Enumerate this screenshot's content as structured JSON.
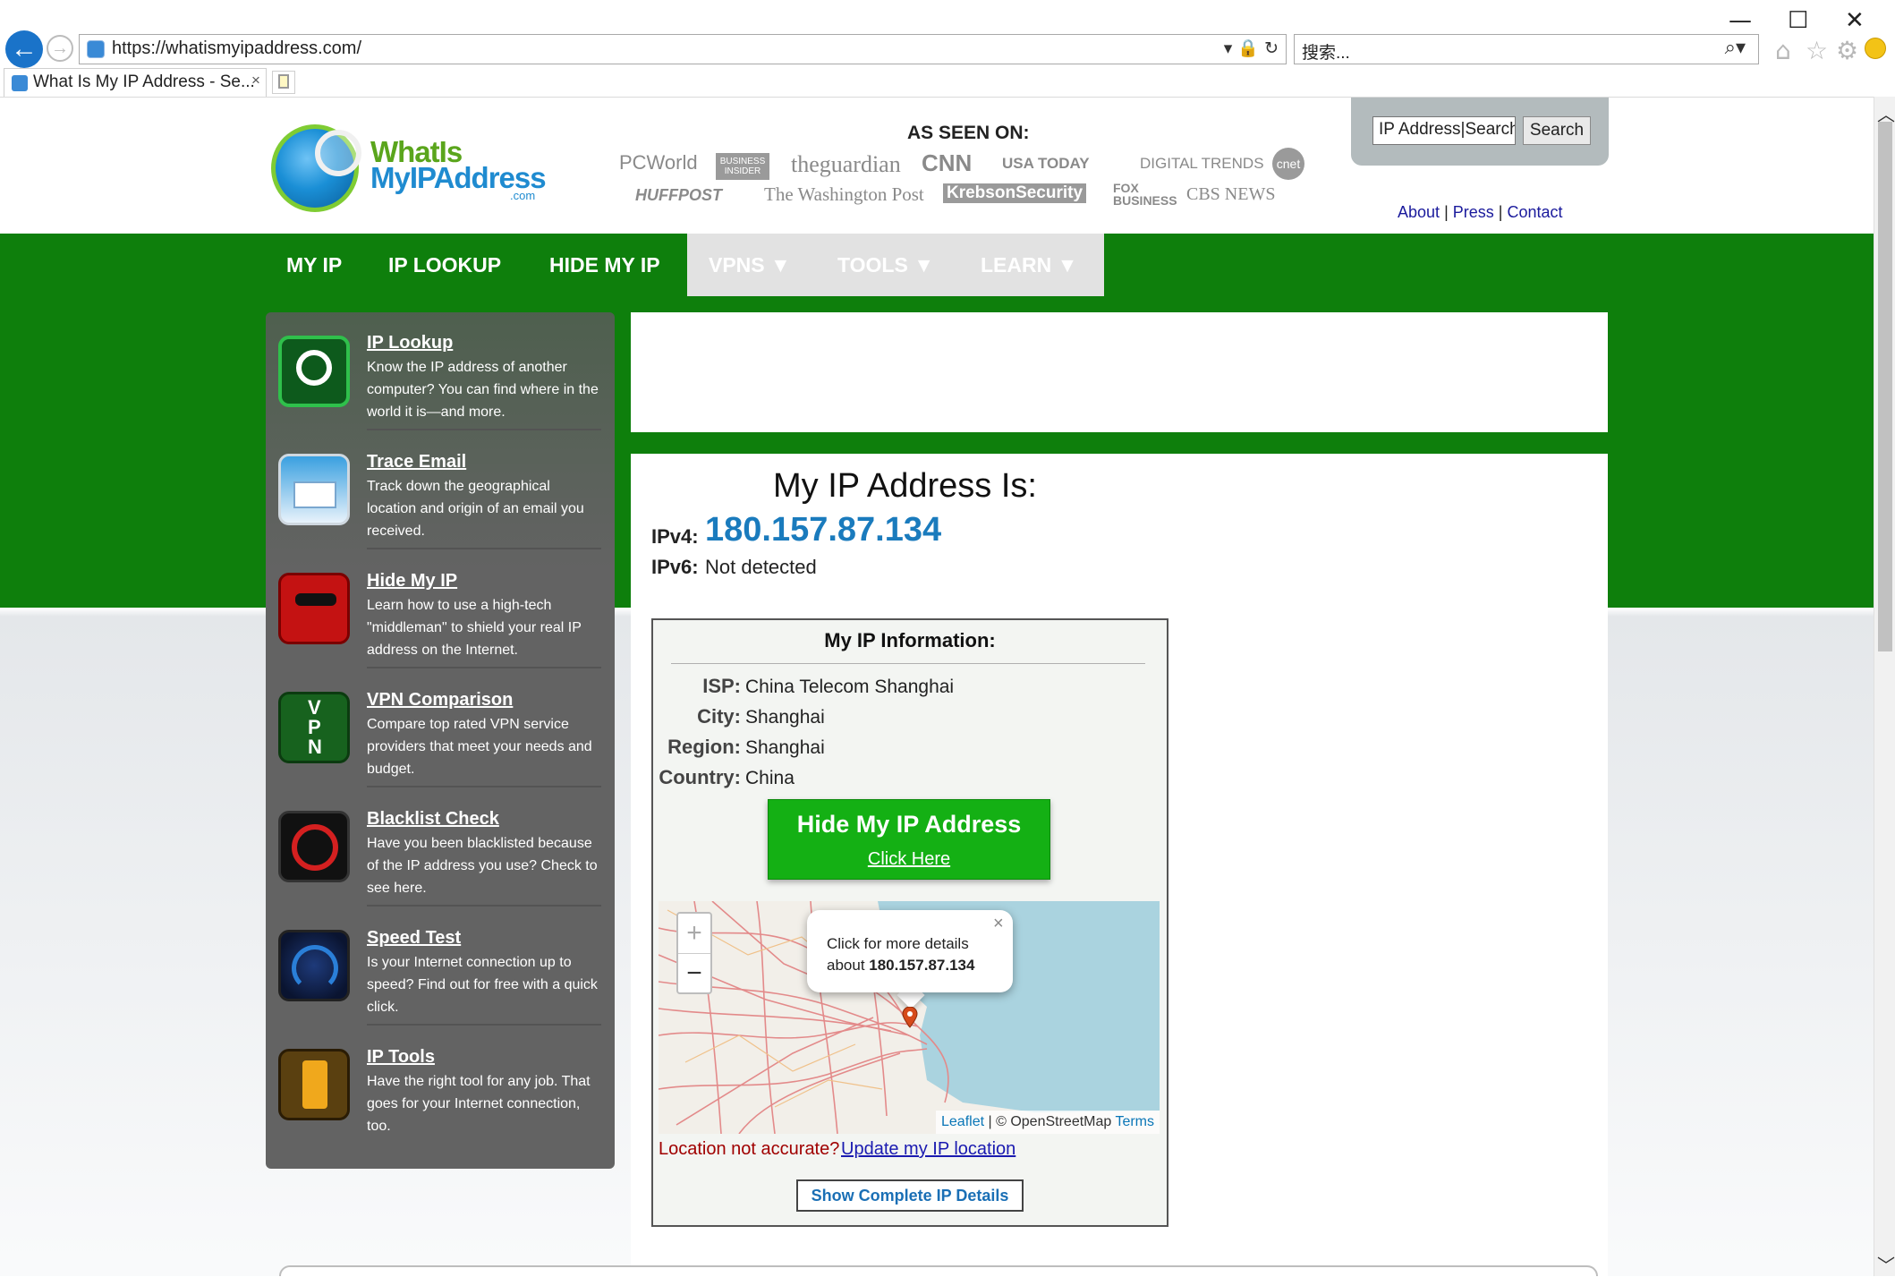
{
  "browser": {
    "window_controls": {
      "minimize": "—",
      "maximize": "☐",
      "close": "✕"
    },
    "url": "https://whatismyipaddress.com/",
    "search_placeholder": "搜索...",
    "tab_title": "What Is My IP Address - Se...",
    "tab_close": "×"
  },
  "header": {
    "logo": {
      "line1": "WhatIs",
      "line2": "MyIPAddress",
      "suffix": ".com"
    },
    "as_seen_on_title": "AS SEEN ON:",
    "press_logos_row1": [
      "PCWorld",
      "BUSINESS INSIDER",
      "theguardian",
      "CNN",
      "USA TODAY",
      "DIGITAL TRENDS",
      "cnet"
    ],
    "press_logos_row2": [
      "HUFFPOST",
      "The Washington Post",
      "KrebsonSecurity",
      "FOX BUSINESS",
      "CBS NEWS"
    ],
    "search": {
      "value": "IP Address|Search",
      "button": "Search"
    },
    "links": {
      "about": "About",
      "press": "Press",
      "contact": "Contact",
      "separator": "|"
    }
  },
  "menu": {
    "items": [
      "MY IP",
      "IP LOOKUP",
      "HIDE MY IP"
    ],
    "greyed_items": [
      "VPNS ▼",
      "TOOLS ▼",
      "LEARN ▼"
    ]
  },
  "sidebar": {
    "items": [
      {
        "title": "IP Lookup",
        "desc": "Know the IP address of another computer? You can find where in the world it is—and more."
      },
      {
        "title": "Trace Email",
        "desc": "Track down the geographical location and origin of an email you received."
      },
      {
        "title": "Hide My IP",
        "desc": "Learn how to use a high-tech \"middleman\" to shield your real IP address on the Internet."
      },
      {
        "title": "VPN Comparison",
        "desc": "Compare top rated VPN service providers that meet your needs and budget."
      },
      {
        "title": "Blacklist Check",
        "desc": "Have you been blacklisted because of the IP address you use? Check to see here."
      },
      {
        "title": "Speed Test",
        "desc": "Is your Internet connection up to speed? Find out for free with a quick click."
      },
      {
        "title": "IP Tools",
        "desc": "Have the right tool for any job. That goes for your Internet connection, too."
      }
    ]
  },
  "ip": {
    "heading": "My IP Address Is:",
    "ipv4_label": "IPv4:",
    "ipv4_value": "180.157.87.134",
    "ipv6_label": "IPv6:",
    "ipv6_value": "Not detected"
  },
  "info": {
    "title": "My IP Information:",
    "rows": [
      {
        "label": "ISP:",
        "value": "China Telecom Shanghai"
      },
      {
        "label": "City:",
        "value": "Shanghai"
      },
      {
        "label": "Region:",
        "value": "Shanghai"
      },
      {
        "label": "Country:",
        "value": "China"
      }
    ],
    "hide_button": {
      "title": "Hide My IP Address",
      "link": "Click Here"
    },
    "map": {
      "zoom_in": "+",
      "zoom_out": "−",
      "popup_line1": "Click for more details",
      "popup_line2_prefix": "about ",
      "popup_ip": "180.157.87.134",
      "popup_close": "×",
      "attrib_leaflet": "Leaflet",
      "attrib_osm": " | © OpenStreetMap ",
      "attrib_terms": "Terms"
    },
    "location_text": "Location not accurate?",
    "location_link": "Update my IP location",
    "details_button": "Show Complete IP Details"
  },
  "colors": {
    "green_band": "#0e7f0c",
    "sidebar": "#636363",
    "ip_blue": "#1a7bbd",
    "hide_button": "#14b014",
    "location_red": "#a00000"
  }
}
